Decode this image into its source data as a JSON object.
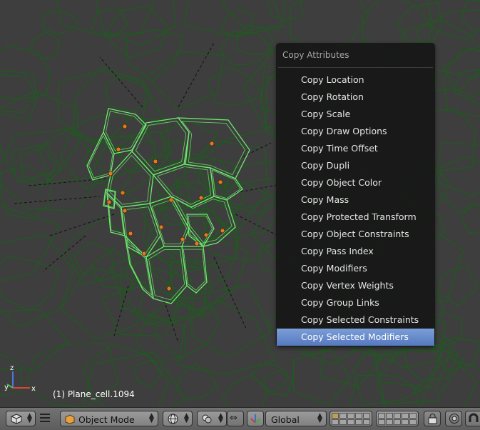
{
  "menu": {
    "title": "Copy Attributes",
    "items": [
      {
        "label": "Copy Location",
        "highlighted": false
      },
      {
        "label": "Copy Rotation",
        "highlighted": false
      },
      {
        "label": "Copy Scale",
        "highlighted": false
      },
      {
        "label": "Copy Draw Options",
        "highlighted": false
      },
      {
        "label": "Copy Time Offset",
        "highlighted": false
      },
      {
        "label": "Copy Dupli",
        "highlighted": false
      },
      {
        "label": "Copy Object Color",
        "highlighted": false
      },
      {
        "label": "Copy Mass",
        "highlighted": false
      },
      {
        "label": "Copy Protected Transform",
        "highlighted": false
      },
      {
        "label": "Copy Object Constraints",
        "highlighted": false
      },
      {
        "label": "Copy Pass Index",
        "highlighted": false
      },
      {
        "label": "Copy Modifiers",
        "highlighted": false
      },
      {
        "label": "Copy Vertex Weights",
        "highlighted": false
      },
      {
        "label": "Copy Group Links",
        "highlighted": false
      },
      {
        "label": "Copy Selected Constraints",
        "highlighted": false
      },
      {
        "label": "Copy Selected Modifiers",
        "highlighted": true
      }
    ]
  },
  "viewport": {
    "object_info": "(1) Plane_cell.1094",
    "axis_labels": {
      "x": "x",
      "y": "y",
      "z": "z"
    }
  },
  "header": {
    "mode_label": "Object Mode",
    "orientation_label": "Global"
  },
  "colors": {
    "viewport_bg": "#3e3e3e",
    "wire_dark": "#1f5a1f",
    "wire_selected": "#6ee86e",
    "vertex_dot": "#e07a20",
    "menu_highlight": "#5a80c8"
  }
}
